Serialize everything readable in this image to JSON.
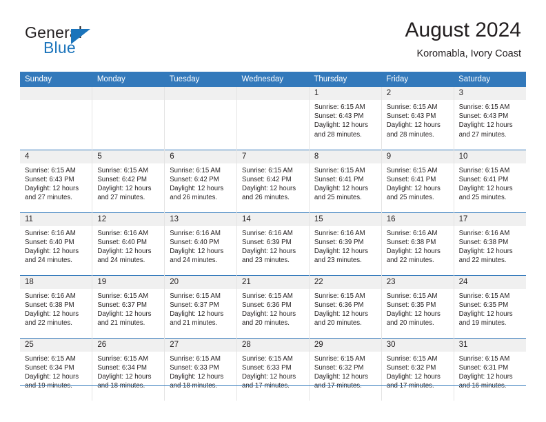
{
  "brand": {
    "name_part1": "General",
    "name_part2": "Blue",
    "triangle_color": "#1b74bb"
  },
  "header": {
    "title": "August 2024",
    "subtitle": "Koromabla, Ivory Coast"
  },
  "theme": {
    "header_blue": "#3379bb",
    "daynum_band": "#f0f0f0",
    "text": "#231f20"
  },
  "weekdays": [
    "Sunday",
    "Monday",
    "Tuesday",
    "Wednesday",
    "Thursday",
    "Friday",
    "Saturday"
  ],
  "labels": {
    "sunrise_prefix": "Sunrise:",
    "sunset_prefix": "Sunset:",
    "daylight_prefix": "Daylight:"
  },
  "weeks": [
    [
      {
        "day": "",
        "empty": true
      },
      {
        "day": "",
        "empty": true
      },
      {
        "day": "",
        "empty": true
      },
      {
        "day": "",
        "empty": true
      },
      {
        "day": "1",
        "sunrise": "Sunrise: 6:15 AM",
        "sunset": "Sunset: 6:43 PM",
        "daylight_l1": "Daylight: 12 hours",
        "daylight_l2": "and 28 minutes."
      },
      {
        "day": "2",
        "sunrise": "Sunrise: 6:15 AM",
        "sunset": "Sunset: 6:43 PM",
        "daylight_l1": "Daylight: 12 hours",
        "daylight_l2": "and 28 minutes."
      },
      {
        "day": "3",
        "sunrise": "Sunrise: 6:15 AM",
        "sunset": "Sunset: 6:43 PM",
        "daylight_l1": "Daylight: 12 hours",
        "daylight_l2": "and 27 minutes."
      }
    ],
    [
      {
        "day": "4",
        "sunrise": "Sunrise: 6:15 AM",
        "sunset": "Sunset: 6:43 PM",
        "daylight_l1": "Daylight: 12 hours",
        "daylight_l2": "and 27 minutes."
      },
      {
        "day": "5",
        "sunrise": "Sunrise: 6:15 AM",
        "sunset": "Sunset: 6:42 PM",
        "daylight_l1": "Daylight: 12 hours",
        "daylight_l2": "and 27 minutes."
      },
      {
        "day": "6",
        "sunrise": "Sunrise: 6:15 AM",
        "sunset": "Sunset: 6:42 PM",
        "daylight_l1": "Daylight: 12 hours",
        "daylight_l2": "and 26 minutes."
      },
      {
        "day": "7",
        "sunrise": "Sunrise: 6:15 AM",
        "sunset": "Sunset: 6:42 PM",
        "daylight_l1": "Daylight: 12 hours",
        "daylight_l2": "and 26 minutes."
      },
      {
        "day": "8",
        "sunrise": "Sunrise: 6:15 AM",
        "sunset": "Sunset: 6:41 PM",
        "daylight_l1": "Daylight: 12 hours",
        "daylight_l2": "and 25 minutes."
      },
      {
        "day": "9",
        "sunrise": "Sunrise: 6:15 AM",
        "sunset": "Sunset: 6:41 PM",
        "daylight_l1": "Daylight: 12 hours",
        "daylight_l2": "and 25 minutes."
      },
      {
        "day": "10",
        "sunrise": "Sunrise: 6:15 AM",
        "sunset": "Sunset: 6:41 PM",
        "daylight_l1": "Daylight: 12 hours",
        "daylight_l2": "and 25 minutes."
      }
    ],
    [
      {
        "day": "11",
        "sunrise": "Sunrise: 6:16 AM",
        "sunset": "Sunset: 6:40 PM",
        "daylight_l1": "Daylight: 12 hours",
        "daylight_l2": "and 24 minutes."
      },
      {
        "day": "12",
        "sunrise": "Sunrise: 6:16 AM",
        "sunset": "Sunset: 6:40 PM",
        "daylight_l1": "Daylight: 12 hours",
        "daylight_l2": "and 24 minutes."
      },
      {
        "day": "13",
        "sunrise": "Sunrise: 6:16 AM",
        "sunset": "Sunset: 6:40 PM",
        "daylight_l1": "Daylight: 12 hours",
        "daylight_l2": "and 24 minutes."
      },
      {
        "day": "14",
        "sunrise": "Sunrise: 6:16 AM",
        "sunset": "Sunset: 6:39 PM",
        "daylight_l1": "Daylight: 12 hours",
        "daylight_l2": "and 23 minutes."
      },
      {
        "day": "15",
        "sunrise": "Sunrise: 6:16 AM",
        "sunset": "Sunset: 6:39 PM",
        "daylight_l1": "Daylight: 12 hours",
        "daylight_l2": "and 23 minutes."
      },
      {
        "day": "16",
        "sunrise": "Sunrise: 6:16 AM",
        "sunset": "Sunset: 6:38 PM",
        "daylight_l1": "Daylight: 12 hours",
        "daylight_l2": "and 22 minutes."
      },
      {
        "day": "17",
        "sunrise": "Sunrise: 6:16 AM",
        "sunset": "Sunset: 6:38 PM",
        "daylight_l1": "Daylight: 12 hours",
        "daylight_l2": "and 22 minutes."
      }
    ],
    [
      {
        "day": "18",
        "sunrise": "Sunrise: 6:16 AM",
        "sunset": "Sunset: 6:38 PM",
        "daylight_l1": "Daylight: 12 hours",
        "daylight_l2": "and 22 minutes."
      },
      {
        "day": "19",
        "sunrise": "Sunrise: 6:15 AM",
        "sunset": "Sunset: 6:37 PM",
        "daylight_l1": "Daylight: 12 hours",
        "daylight_l2": "and 21 minutes."
      },
      {
        "day": "20",
        "sunrise": "Sunrise: 6:15 AM",
        "sunset": "Sunset: 6:37 PM",
        "daylight_l1": "Daylight: 12 hours",
        "daylight_l2": "and 21 minutes."
      },
      {
        "day": "21",
        "sunrise": "Sunrise: 6:15 AM",
        "sunset": "Sunset: 6:36 PM",
        "daylight_l1": "Daylight: 12 hours",
        "daylight_l2": "and 20 minutes."
      },
      {
        "day": "22",
        "sunrise": "Sunrise: 6:15 AM",
        "sunset": "Sunset: 6:36 PM",
        "daylight_l1": "Daylight: 12 hours",
        "daylight_l2": "and 20 minutes."
      },
      {
        "day": "23",
        "sunrise": "Sunrise: 6:15 AM",
        "sunset": "Sunset: 6:35 PM",
        "daylight_l1": "Daylight: 12 hours",
        "daylight_l2": "and 20 minutes."
      },
      {
        "day": "24",
        "sunrise": "Sunrise: 6:15 AM",
        "sunset": "Sunset: 6:35 PM",
        "daylight_l1": "Daylight: 12 hours",
        "daylight_l2": "and 19 minutes."
      }
    ],
    [
      {
        "day": "25",
        "sunrise": "Sunrise: 6:15 AM",
        "sunset": "Sunset: 6:34 PM",
        "daylight_l1": "Daylight: 12 hours",
        "daylight_l2": "and 19 minutes."
      },
      {
        "day": "26",
        "sunrise": "Sunrise: 6:15 AM",
        "sunset": "Sunset: 6:34 PM",
        "daylight_l1": "Daylight: 12 hours",
        "daylight_l2": "and 18 minutes."
      },
      {
        "day": "27",
        "sunrise": "Sunrise: 6:15 AM",
        "sunset": "Sunset: 6:33 PM",
        "daylight_l1": "Daylight: 12 hours",
        "daylight_l2": "and 18 minutes."
      },
      {
        "day": "28",
        "sunrise": "Sunrise: 6:15 AM",
        "sunset": "Sunset: 6:33 PM",
        "daylight_l1": "Daylight: 12 hours",
        "daylight_l2": "and 17 minutes."
      },
      {
        "day": "29",
        "sunrise": "Sunrise: 6:15 AM",
        "sunset": "Sunset: 6:32 PM",
        "daylight_l1": "Daylight: 12 hours",
        "daylight_l2": "and 17 minutes."
      },
      {
        "day": "30",
        "sunrise": "Sunrise: 6:15 AM",
        "sunset": "Sunset: 6:32 PM",
        "daylight_l1": "Daylight: 12 hours",
        "daylight_l2": "and 17 minutes."
      },
      {
        "day": "31",
        "sunrise": "Sunrise: 6:15 AM",
        "sunset": "Sunset: 6:31 PM",
        "daylight_l1": "Daylight: 12 hours",
        "daylight_l2": "and 16 minutes."
      }
    ]
  ]
}
